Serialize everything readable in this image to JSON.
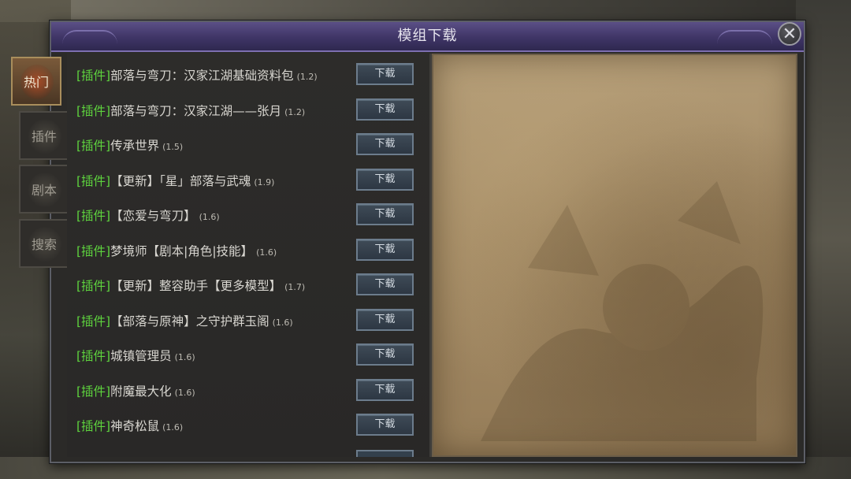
{
  "window": {
    "title": "模组下载",
    "close_symbol": "✕"
  },
  "tabs": [
    {
      "label": "热门",
      "active": true
    },
    {
      "label": "插件",
      "active": false
    },
    {
      "label": "剧本",
      "active": false
    },
    {
      "label": "搜索",
      "active": false
    }
  ],
  "list": {
    "items": [
      {
        "tag": "[插件]",
        "name": "部落与弯刀：汉家江湖基础资料包",
        "version": "(1.2)",
        "button": "下载"
      },
      {
        "tag": "[插件]",
        "name": "部落与弯刀：汉家江湖——张月",
        "version": "(1.2)",
        "button": "下载"
      },
      {
        "tag": "[插件]",
        "name": "传承世界",
        "version": "(1.5)",
        "button": "下载"
      },
      {
        "tag": "[插件]",
        "name": "【更新】「星」部落与武魂",
        "version": "(1.9)",
        "button": "下载"
      },
      {
        "tag": "[插件]",
        "name": "【恋爱与弯刀】",
        "version": "(1.6)",
        "button": "下载"
      },
      {
        "tag": "[插件]",
        "name": "梦境师【剧本|角色|技能】",
        "version": "(1.6)",
        "button": "下载"
      },
      {
        "tag": "[插件]",
        "name": "【更新】整容助手【更多模型】",
        "version": "(1.7)",
        "button": "下载"
      },
      {
        "tag": "[插件]",
        "name": "【部落与原神】之守护群玉阁",
        "version": "(1.6)",
        "button": "下载"
      },
      {
        "tag": "[插件]",
        "name": "城镇管理员",
        "version": "(1.6)",
        "button": "下载"
      },
      {
        "tag": "[插件]",
        "name": "附魔最大化",
        "version": "(1.6)",
        "button": "下载"
      },
      {
        "tag": "[插件]",
        "name": "神奇松鼠",
        "version": "(1.6)",
        "button": "下载"
      }
    ]
  },
  "colors": {
    "tag_green": "#5ed33e",
    "title_bar_purple": "#3f3566",
    "parchment": "#a48b65"
  },
  "icons": {
    "close": "close-icon"
  }
}
